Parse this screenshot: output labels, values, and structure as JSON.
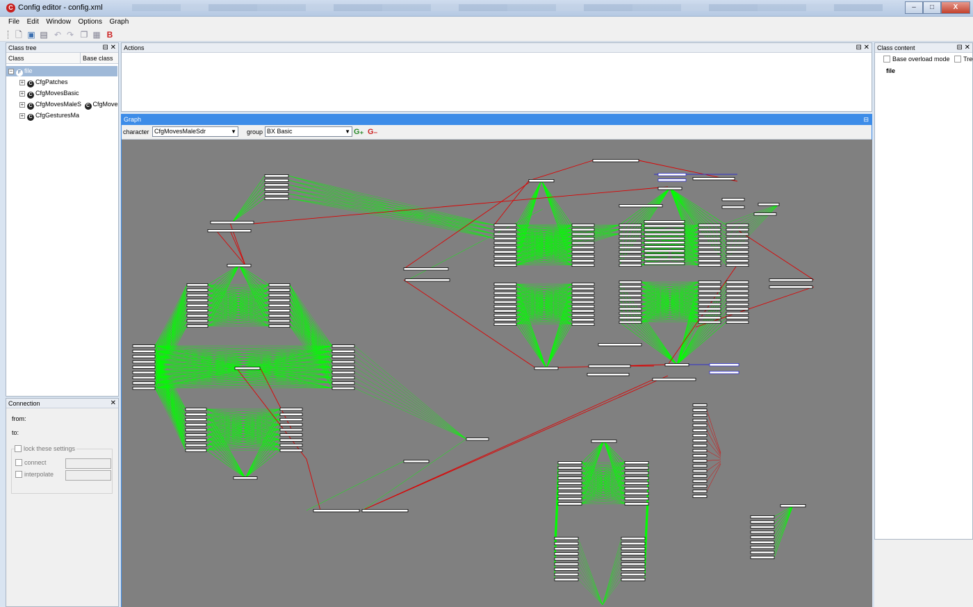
{
  "window": {
    "title": "Config editor - config.xml",
    "minimize": "–",
    "maximize": "□",
    "close": "X"
  },
  "menu": [
    "File",
    "Edit",
    "Window",
    "Options",
    "Graph"
  ],
  "class_tree": {
    "title": "Class tree",
    "col_class": "Class",
    "col_base": "Base class",
    "root": "file",
    "items": [
      "CfgPatches",
      "CfgMovesBasic",
      "CfgMovesMaleS",
      "CfgGesturesMa"
    ],
    "base_of_item3": "CfgMoves"
  },
  "actions": {
    "title": "Actions"
  },
  "connection": {
    "title": "Connection",
    "from": "from:",
    "to": "to:",
    "lock": "lock these settings",
    "connect": "connect",
    "interpolate": "interpolate"
  },
  "graph": {
    "title": "Graph",
    "character_label": "character",
    "character_value": "CfgMovesMaleSdr",
    "group_label": "group",
    "group_value": "BX Basic",
    "add_btn": "G₊",
    "remove_btn": "G₋",
    "colors": {
      "background": "#808080",
      "edge_normal": "#00ff00",
      "edge_red": "#dd0000",
      "edge_blue": "#3030cc",
      "node_fill": "#ffffff",
      "node_border": "#000000"
    }
  },
  "class_content": {
    "title": "Class content",
    "base_overload": "Base overload mode",
    "tree": "Tree",
    "root": "file"
  }
}
